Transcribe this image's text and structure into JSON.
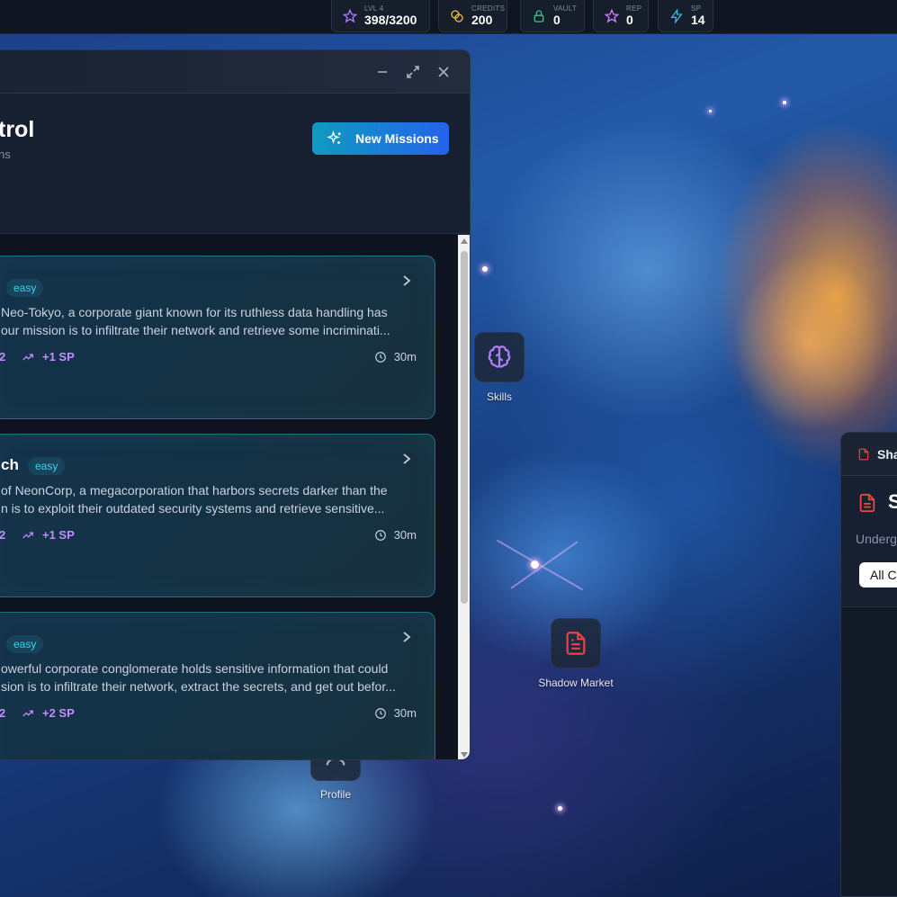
{
  "stats": [
    {
      "label": "LVL 4",
      "value": "398/3200",
      "icon": "star-icon",
      "color": "#b07cff"
    },
    {
      "label": "CREDITS",
      "value": "200",
      "icon": "coins-icon",
      "color": "#e5c23a"
    },
    {
      "label": "VAULT",
      "value": "0",
      "icon": "lock-icon",
      "color": "#2fc98a"
    },
    {
      "label": "REP",
      "value": "0",
      "icon": "star-icon",
      "color": "#d07cff"
    },
    {
      "label": "SP",
      "value": "14",
      "icon": "lightning-icon",
      "color": "#37b6e6"
    }
  ],
  "mission_window": {
    "title_fragment": "trol",
    "subtitle_fragment": "ns",
    "new_missions_label": "New Missions",
    "missions": [
      {
        "title_fragment": "",
        "difficulty": "easy",
        "desc_line1": "Neo-Tokyo, a corporate giant known for its ruthless data handling has",
        "desc_line2": "our mission is to infiltrate their network and retrieve some incriminati...",
        "credits_fragment": "2",
        "sp": "+1 SP",
        "time": "30m"
      },
      {
        "title_fragment": "ch",
        "difficulty": "easy",
        "desc_line1": "of NeonCorp, a megacorporation that harbors secrets darker than the",
        "desc_line2": "n is to exploit their outdated security systems and retrieve sensitive...",
        "credits_fragment": "2",
        "sp": "+1 SP",
        "time": "30m"
      },
      {
        "title_fragment": "",
        "difficulty": "easy",
        "desc_line1": "owerful corporate conglomerate holds sensitive information that could",
        "desc_line2": "sion is to infiltrate their network, extract the secrets, and get out befor...",
        "credits_fragment": "2",
        "sp": "+2 SP",
        "time": "30m"
      }
    ]
  },
  "desktop_icons": [
    {
      "label": "Skills",
      "icon": "brain-icon",
      "color": "#b07cff"
    },
    {
      "label": "Shadow Market",
      "icon": "document-icon",
      "color": "#ef4444"
    },
    {
      "label": "Profile",
      "icon": "profile-icon",
      "color": "#aab4c4"
    }
  ],
  "shadow_panel": {
    "tab_fragment": "Sha",
    "heading_fragment": "S",
    "subtitle_fragment": "Underg",
    "filter_fragment": "All C"
  }
}
